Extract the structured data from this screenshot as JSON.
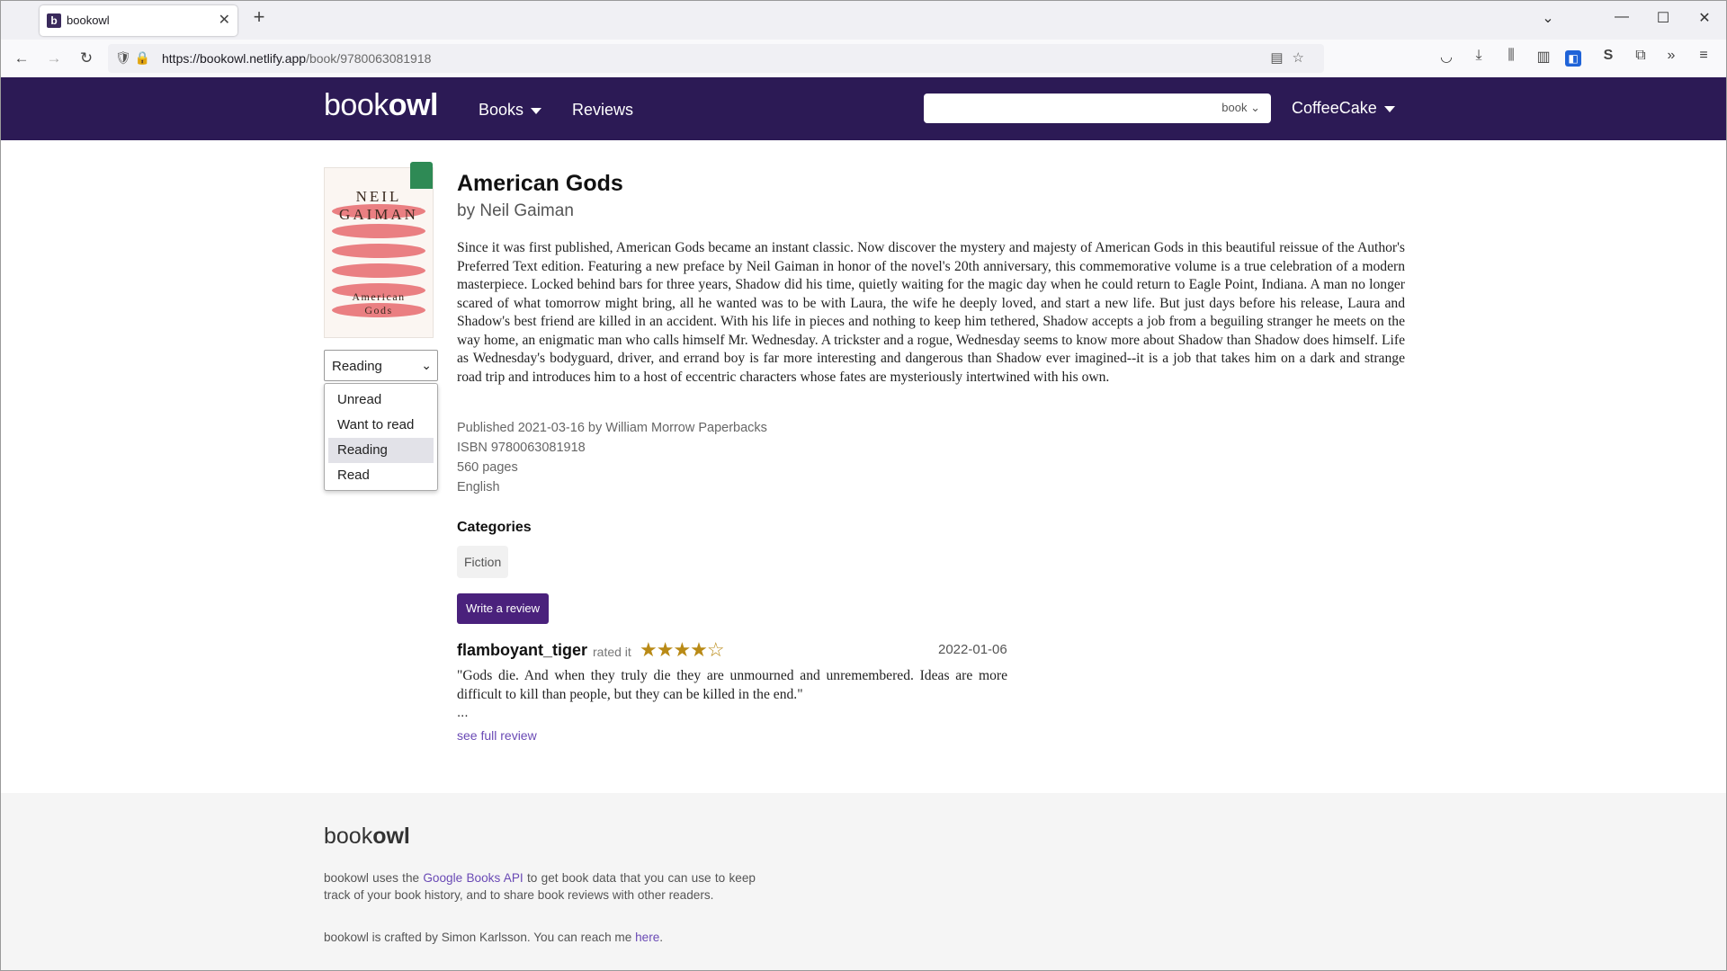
{
  "browser": {
    "tab_title": "bookowl",
    "favicon_letter": "b",
    "url_domain": "https://bookowl.netlify.app",
    "url_path": "/book/9780063081918",
    "tab_close": "✕",
    "new_tab": "+",
    "nav_icons": {
      "back": "←",
      "forward": "→",
      "reload": "↻"
    },
    "window": {
      "list": "⌄",
      "minimize": "—",
      "maximize": "☐",
      "close": "✕"
    }
  },
  "header": {
    "logo_light": "book",
    "logo_bold": "owl",
    "nav": {
      "books": "Books",
      "reviews": "Reviews"
    },
    "search": {
      "placeholder": "",
      "type_value": "book"
    },
    "user": "CoffeeCake"
  },
  "book": {
    "cover": {
      "author": "NEIL GAIMAN",
      "title_line1": "American",
      "title_line2": "Gods"
    },
    "title": "American Gods",
    "author_line": "by Neil Gaiman",
    "description": "Since it was first published, American Gods became an instant classic. Now discover the mystery and majesty of American Gods in this beautiful reissue of the Author's Preferred Text edition. Featuring a new preface by Neil Gaiman in honor of the novel's 20th anniversary, this commemorative volume is a true celebration of a modern masterpiece. Locked behind bars for three years, Shadow did his time, quietly waiting for the magic day when he could return to Eagle Point, Indiana. A man no longer scared of what tomorrow might bring, all he wanted was to be with Laura, the wife he deeply loved, and start a new life. But just days before his release, Laura and Shadow's best friend are killed in an accident. With his life in pieces and nothing to keep him tethered, Shadow accepts a job from a beguiling stranger he meets on the way home, an enigmatic man who calls himself Mr. Wednesday. A trickster and a rogue, Wednesday seems to know more about Shadow than Shadow does himself. Life as Wednesday's bodyguard, driver, and errand boy is far more interesting and dangerous than Shadow ever imagined--it is a job that takes him on a dark and strange road trip and introduces him to a host of eccentric characters whose fates are mysteriously intertwined with his own.",
    "published": "Published 2021-03-16 by William Morrow Paperbacks",
    "isbn": "ISBN 9780063081918",
    "pages": "560 pages",
    "language": "English",
    "categories_heading": "Categories",
    "categories": [
      "Fiction"
    ],
    "status": {
      "selected": "Reading",
      "options": [
        "Unread",
        "Want to read",
        "Reading",
        "Read"
      ]
    },
    "write_review": "Write a review"
  },
  "review": {
    "username": "flamboyant_tiger",
    "rated_label": "rated it",
    "stars": "★★★★☆",
    "rating": 4,
    "date": "2022-01-06",
    "text": "\"Gods die. And when they truly die they are unmourned and unremembered. Ideas are more difficult to kill than people, but they can be killed in the end.\"",
    "ellipsis": "...",
    "see_full": "see full review"
  },
  "footer": {
    "logo_light": "book",
    "logo_bold": "owl",
    "p1_before": "bookowl uses the ",
    "p1_link": "Google Books API",
    "p1_after": " to get book data that you can use to keep track of your book history, and to share book reviews with other readers.",
    "p2_before": "bookowl is crafted by Simon Karlsson. You can reach me ",
    "p2_link": "here",
    "p2_after": "."
  },
  "colors": {
    "header_bg": "#2c1a55",
    "button_bg": "#4a217c",
    "link": "#6a4ab5",
    "star": "#b98a16",
    "bookmark": "#2e8a55"
  }
}
